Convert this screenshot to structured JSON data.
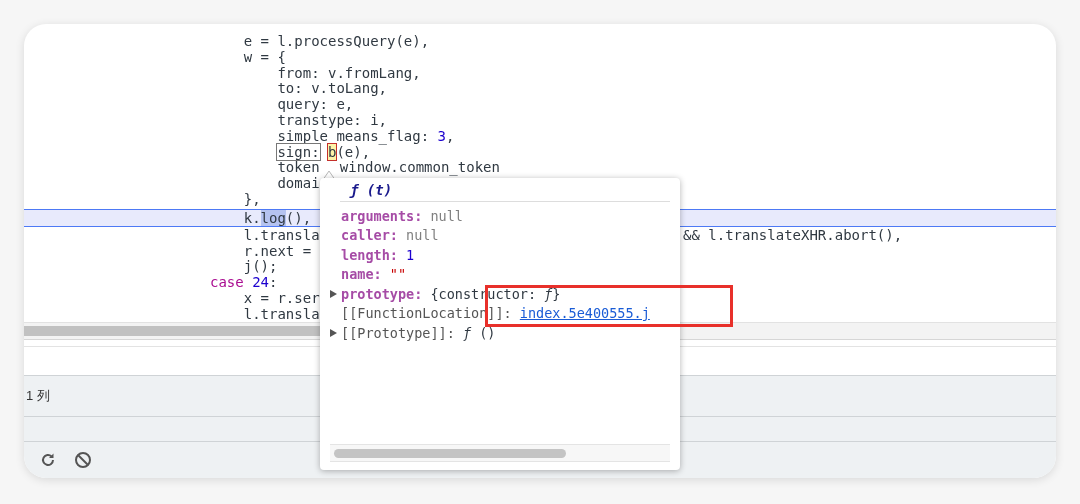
{
  "code_lines": [
    {
      "children": [
        {
          "current": false,
          "segments": [
            {
              "kind": "plain",
              "text": "e = l.processQuery(e),"
            }
          ]
        },
        {
          "current": false,
          "segments": [
            {
              "kind": "plain",
              "text": "w = {"
            }
          ],
          "children": [
            {
              "current": false,
              "segments": [
                {
                  "kind": "plain",
                  "text": "from: v.fromLang,"
                }
              ]
            },
            {
              "current": false,
              "segments": [
                {
                  "kind": "plain",
                  "text": "to: v.toLang,"
                }
              ]
            },
            {
              "current": false,
              "segments": [
                {
                  "kind": "plain",
                  "text": "query: e,"
                }
              ]
            },
            {
              "current": false,
              "segments": [
                {
                  "kind": "plain",
                  "text": "transtype: i,"
                }
              ]
            },
            {
              "current": false,
              "segments": [
                {
                  "kind": "plain",
                  "text": "simple_means_flag: "
                },
                {
                  "kind": "number",
                  "text": "3"
                },
                {
                  "kind": "plain",
                  "text": ","
                }
              ]
            },
            {
              "current": false,
              "segments": [
                {
                  "kind": "boxed",
                  "text": "sign:"
                },
                {
                  "kind": "hit",
                  "text": "b"
                },
                {
                  "kind": "plain",
                  "text": "(e),"
                }
              ]
            },
            {
              "current": false,
              "segments": [
                {
                  "kind": "plain",
                  "text": "token"
                }
              ],
              "tail": {
                "kind": "near",
                "text": "window.common_token"
              }
            },
            {
              "current": false,
              "segments": [
                {
                  "kind": "plain",
                  "text": "domai"
                }
              ]
            }
          ]
        },
        {
          "current": false,
          "segments": [
            {
              "kind": "plain",
              "text": "},"
            }
          ]
        },
        {
          "current": true,
          "segments": [
            {
              "kind": "plain",
              "text": "k."
            },
            {
              "kind": "selected",
              "text": "log"
            },
            {
              "kind": "plain",
              "text": "(),"
            }
          ]
        },
        {
          "current": false,
          "segments": [
            {
              "kind": "plain",
              "text": "l.transla"
            }
          ],
          "tail": {
            "kind": "far",
            "text": "&& l.translateXHR.abort(),"
          }
        },
        {
          "current": false,
          "segments": [
            {
              "kind": "plain",
              "text": "r.next ="
            }
          ]
        },
        {
          "current": false,
          "segments": [
            {
              "kind": "plain",
              "text": "j();"
            }
          ]
        }
      ]
    },
    {
      "current": false,
      "segments": [
        {
          "kind": "keyword",
          "text": "case"
        },
        {
          "kind": "number",
          "text": "24"
        },
        {
          "kind": "plain",
          "text": ":"
        }
      ],
      "children": [
        {
          "current": false,
          "segments": [
            {
              "kind": "plain",
              "text": "x = r.ser"
            }
          ]
        },
        {
          "current": false,
          "segments": [
            {
              "kind": "plain",
              "text": "l.transla"
            }
          ]
        }
      ]
    }
  ],
  "popup": {
    "title": "ƒ (t)",
    "properties": [
      {
        "name": "arguments:",
        "value": "null",
        "kind": "null",
        "expandable": false
      },
      {
        "name": "caller:",
        "value": "null",
        "kind": "null",
        "expandable": false
      },
      {
        "name": "length:",
        "value": "1",
        "kind": "number",
        "expandable": false
      },
      {
        "name": "name:",
        "value": "\"\"",
        "kind": "string",
        "expandable": false
      },
      {
        "name": "prototype:",
        "value": "{constructor: *ƒ*}",
        "kind": "object",
        "expandable": true
      },
      {
        "name": "[[FunctionLocation]]:",
        "value": "index.5e400555.j",
        "kind": "location",
        "expandable": false
      },
      {
        "name": "[[Prototype]]:",
        "value": "*ƒ* ()",
        "kind": "internal",
        "expandable": true
      }
    ]
  },
  "status_bar": {
    "position": "1 列"
  }
}
